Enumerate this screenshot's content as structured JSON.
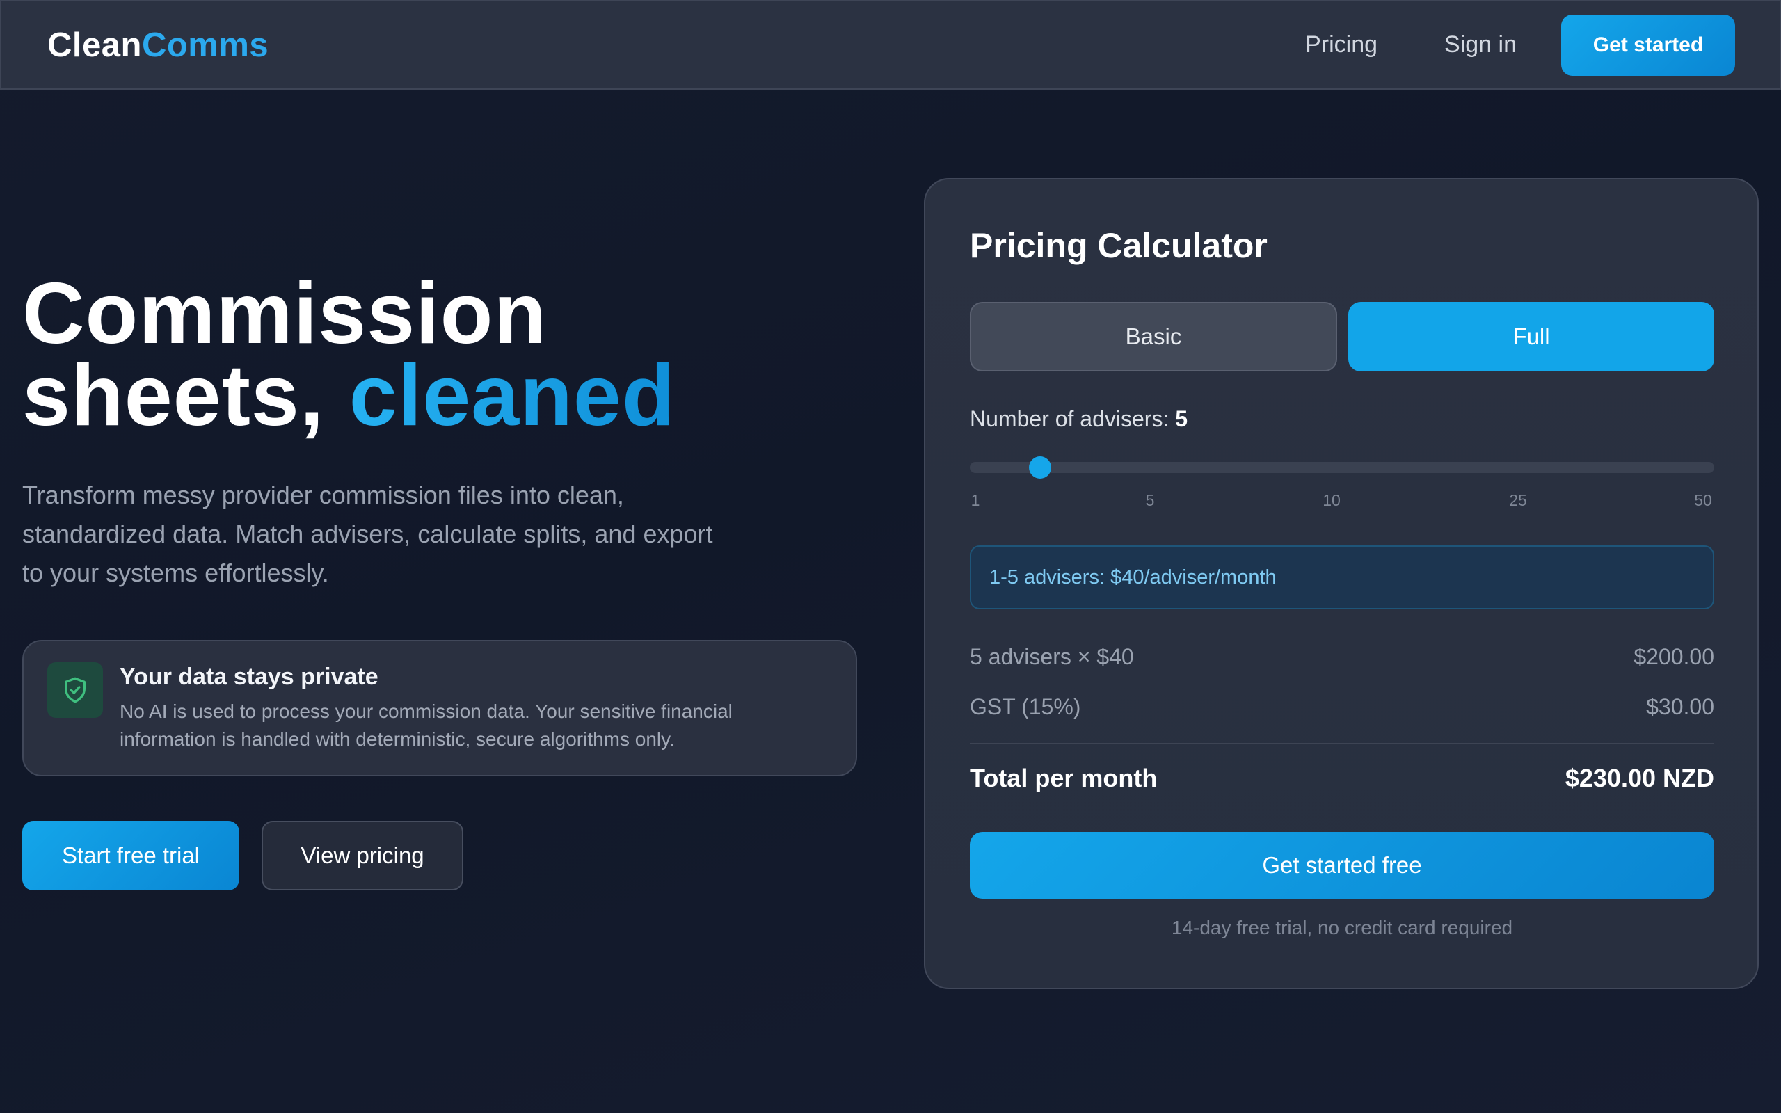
{
  "nav": {
    "brand_part1": "Clean",
    "brand_part2": "Comms",
    "pricing_link": "Pricing",
    "signin_link": "Sign in",
    "cta_label": "Get started"
  },
  "hero": {
    "title_line1": "Commission",
    "title_line2_prefix": "sheets, ",
    "title_line2_accent": "cleaned",
    "description": "Transform messy provider commission files into clean, standardized data. Match advisers, calculate splits, and export to your systems effortlessly.",
    "privacy": {
      "icon": "shield-check-icon",
      "title": "Your data stays private",
      "body": "No AI is used to process your commission data. Your sensitive financial information is handled with deterministic, secure algorithms only."
    },
    "primary_button": "Start free trial",
    "secondary_button": "View pricing"
  },
  "calculator": {
    "title": "Pricing Calculator",
    "plans": [
      {
        "label": "Basic",
        "selected": false
      },
      {
        "label": "Full",
        "selected": true
      }
    ],
    "advisers_label": "Number of advisers: ",
    "advisers_value": "5",
    "slider": {
      "value_fraction": 0.094,
      "ticks": [
        "1",
        "5",
        "10",
        "25",
        "50"
      ]
    },
    "tier_note": "1-5 advisers: $40/adviser/month",
    "line_items": [
      {
        "label": "5 advisers × $40",
        "amount": "$200.00"
      },
      {
        "label": "GST (15%)",
        "amount": "$30.00"
      }
    ],
    "total_label": "Total per month",
    "total_amount": "$230.00 NZD",
    "cta_label": "Get started free",
    "note": "14-day free trial, no credit card required"
  },
  "colors": {
    "accent": "#12a5e9",
    "background": "#131a2b",
    "card": "#2a3141",
    "privacy_icon": "#3fbf7f"
  }
}
